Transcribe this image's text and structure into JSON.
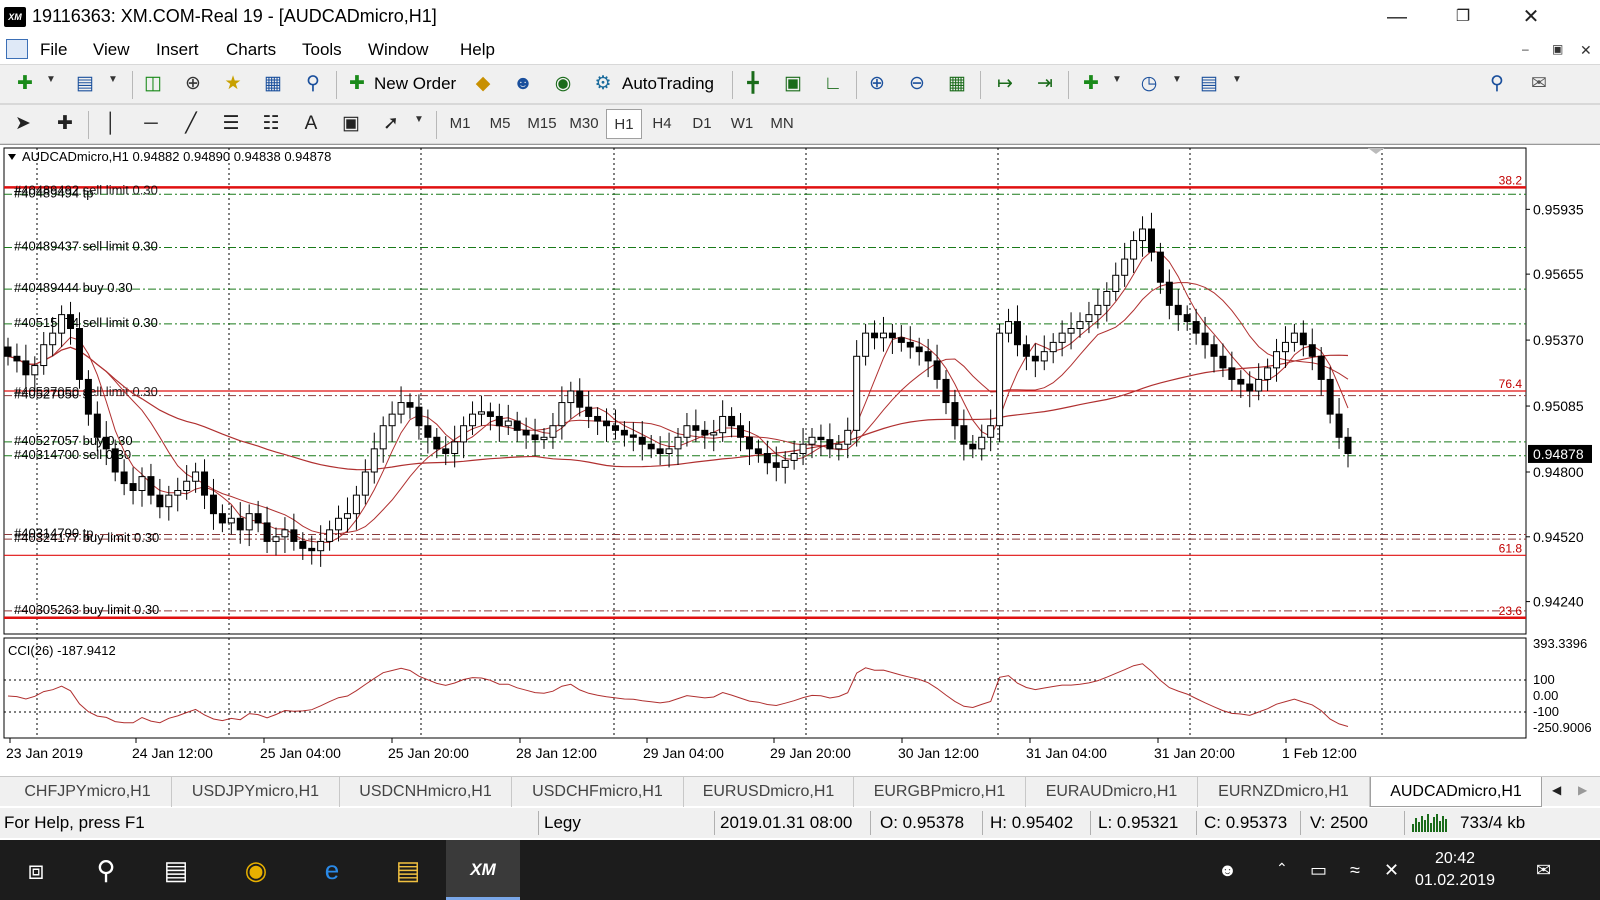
{
  "window": {
    "title": "19116363: XM.COM-Real 19 - [AUDCADmicro,H1]",
    "app_icon_text": "XM"
  },
  "menu": [
    "File",
    "View",
    "Insert",
    "Charts",
    "Tools",
    "Window",
    "Help"
  ],
  "toolbar": {
    "new_order_label": "New Order",
    "autotrading_label": "AutoTrading"
  },
  "timeframes": [
    "M1",
    "M5",
    "M15",
    "M30",
    "H1",
    "H4",
    "D1",
    "W1",
    "MN"
  ],
  "active_timeframe": "H1",
  "chart": {
    "header": "AUDCADmicro,H1  0.94882 0.94890 0.94838 0.94878",
    "current_price": "0.94878",
    "price_ticks": [
      "0.95935",
      "0.95655",
      "0.95370",
      "0.95085",
      "0.94800",
      "0.94520",
      "0.94240"
    ],
    "time_ticks": [
      "23 Jan 2019",
      "24 Jan 12:00",
      "25 Jan 04:00",
      "25 Jan 20:00",
      "28 Jan 12:00",
      "29 Jan 04:00",
      "29 Jan 20:00",
      "30 Jan 12:00",
      "31 Jan 04:00",
      "31 Jan 20:00",
      "1 Feb 12:00"
    ],
    "fib_levels": [
      {
        "label": "38.2",
        "price": 0.9603
      },
      {
        "label": "76.4",
        "price": 0.9515
      },
      {
        "label": "61.8",
        "price": 0.9444
      },
      {
        "label": "23.6",
        "price": 0.9417
      }
    ],
    "order_labels": [
      {
        "text": "#40489494 tp",
        "price": 0.96
      },
      {
        "text": "#40489437 sell limit 0.30",
        "price": 0.9577
      },
      {
        "text": "#40489444 buy 0.30",
        "price": 0.9559
      },
      {
        "text": "#40515974 sell limit 0.30",
        "price": 0.9544
      },
      {
        "text": "#40527050 sl",
        "price": 0.9513
      },
      {
        "text": "#40527057 buy 0.30",
        "price": 0.9493
      },
      {
        "text": "#40314700 sell 0.30",
        "price": 0.9487
      },
      {
        "text": "#40314700 tp",
        "price": 0.9453
      },
      {
        "text": "#40324177 buy limit 0.30",
        "price": 0.9451
      },
      {
        "text": "#40305263 buy limit 0.30",
        "price": 0.942
      }
    ],
    "order_overlay_text": [
      {
        "text": "#40489492 sell limit 0.30",
        "price": 0.9602
      },
      {
        "text": "#40527050 sell limit 0.30",
        "price": 0.9515
      }
    ],
    "indicator": {
      "name": "CCI(26) -187.9412",
      "ticks": [
        "393.3396",
        "100",
        "0.00",
        "-100",
        "-250.9006"
      ]
    }
  },
  "chart_data": {
    "type": "candlestick",
    "title": "AUDCADmicro,H1",
    "ylim": [
      0.941,
      0.962
    ],
    "y_axis_ticks": [
      0.95935,
      0.95655,
      0.9537,
      0.95085,
      0.948,
      0.9452,
      0.9424
    ],
    "closes": [
      0.953,
      0.9528,
      0.9522,
      0.9526,
      0.9535,
      0.954,
      0.9548,
      0.9542,
      0.952,
      0.9505,
      0.9495,
      0.949,
      0.948,
      0.9475,
      0.9472,
      0.9478,
      0.947,
      0.9465,
      0.947,
      0.9472,
      0.9476,
      0.948,
      0.947,
      0.9462,
      0.9458,
      0.946,
      0.9455,
      0.9462,
      0.9458,
      0.945,
      0.9452,
      0.9455,
      0.945,
      0.9447,
      0.9446,
      0.945,
      0.9455,
      0.946,
      0.9462,
      0.947,
      0.948,
      0.949,
      0.95,
      0.9505,
      0.951,
      0.9508,
      0.95,
      0.9495,
      0.949,
      0.9488,
      0.9493,
      0.95,
      0.9505,
      0.9506,
      0.9504,
      0.95,
      0.9502,
      0.9498,
      0.9496,
      0.9494,
      0.9495,
      0.95,
      0.951,
      0.9515,
      0.9508,
      0.9504,
      0.9502,
      0.95,
      0.9498,
      0.9496,
      0.9495,
      0.9492,
      0.949,
      0.9488,
      0.949,
      0.9495,
      0.95,
      0.9498,
      0.9496,
      0.9497,
      0.9504,
      0.95,
      0.9495,
      0.949,
      0.9488,
      0.9484,
      0.9482,
      0.9485,
      0.9488,
      0.9492,
      0.9495,
      0.9494,
      0.949,
      0.9492,
      0.9498,
      0.953,
      0.954,
      0.9538,
      0.954,
      0.9538,
      0.9536,
      0.9534,
      0.9532,
      0.9528,
      0.952,
      0.951,
      0.95,
      0.9492,
      0.949,
      0.9495,
      0.95,
      0.954,
      0.9545,
      0.9535,
      0.953,
      0.9528,
      0.9532,
      0.9536,
      0.954,
      0.9542,
      0.9545,
      0.9548,
      0.9552,
      0.9558,
      0.9565,
      0.9572,
      0.958,
      0.9585,
      0.9575,
      0.9562,
      0.9552,
      0.9548,
      0.9545,
      0.954,
      0.9535,
      0.953,
      0.9525,
      0.952,
      0.9518,
      0.9515,
      0.952,
      0.9525,
      0.9532,
      0.9536,
      0.954,
      0.9535,
      0.953,
      0.952,
      0.9505,
      0.9495,
      0.9488
    ]
  }
}
